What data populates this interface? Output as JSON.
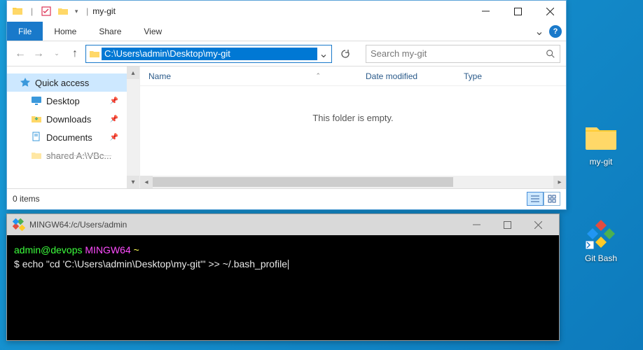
{
  "explorer": {
    "title": "my-git",
    "menu": {
      "file": "File",
      "home": "Home",
      "share": "Share",
      "view": "View"
    },
    "address_path": "C:\\Users\\admin\\Desktop\\my-git",
    "search_placeholder": "Search my-git",
    "nav": {
      "quick_access": "Quick access",
      "items": [
        {
          "label": "Desktop",
          "icon": "desktop"
        },
        {
          "label": "Downloads",
          "icon": "downloads"
        },
        {
          "label": "Documents",
          "icon": "documents"
        },
        {
          "label": "shared A:\\VBc...",
          "icon": "folder",
          "partial": true
        }
      ]
    },
    "columns": {
      "name": "Name",
      "date": "Date modified",
      "type": "Type"
    },
    "empty_message": "This folder is empty.",
    "status": "0 items"
  },
  "terminal": {
    "title": "MINGW64:/c/Users/admin",
    "prompt_user": "admin@devops",
    "prompt_sys": "MINGW64",
    "prompt_path": "~",
    "command": "echo \"cd 'C:\\Users\\admin\\Desktop\\my-git'\" >> ~/.bash_profile"
  },
  "desktop": {
    "folder_label": "my-git",
    "gitbash_label": "Git Bash"
  }
}
